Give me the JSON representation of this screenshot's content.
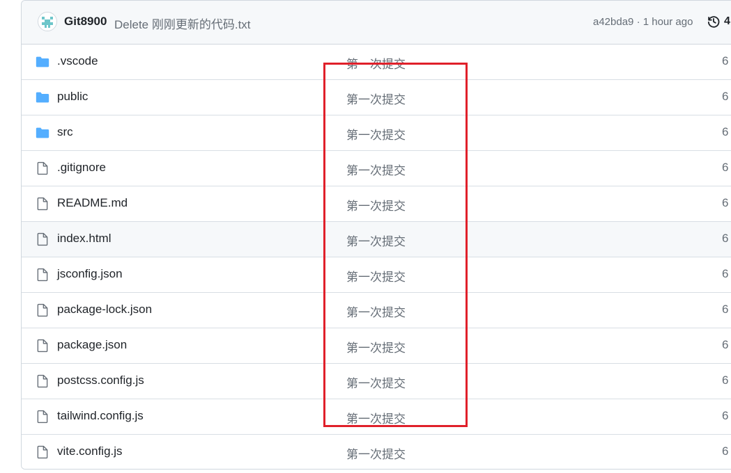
{
  "commit": {
    "author": "Git8900",
    "message": "Delete 刚刚更新的代码.txt",
    "meta": "a42bda9 · 1 hour ago",
    "history_count": "4"
  },
  "files": [
    {
      "type": "folder",
      "name": ".vscode",
      "commit": "第一次提交",
      "age": "6"
    },
    {
      "type": "folder",
      "name": "public",
      "commit": "第一次提交",
      "age": "6"
    },
    {
      "type": "folder",
      "name": "src",
      "commit": "第一次提交",
      "age": "6"
    },
    {
      "type": "file",
      "name": ".gitignore",
      "commit": "第一次提交",
      "age": "6"
    },
    {
      "type": "file",
      "name": "README.md",
      "commit": "第一次提交",
      "age": "6"
    },
    {
      "type": "file",
      "name": "index.html",
      "commit": "第一次提交",
      "age": "6"
    },
    {
      "type": "file",
      "name": "jsconfig.json",
      "commit": "第一次提交",
      "age": "6"
    },
    {
      "type": "file",
      "name": "package-lock.json",
      "commit": "第一次提交",
      "age": "6"
    },
    {
      "type": "file",
      "name": "package.json",
      "commit": "第一次提交",
      "age": "6"
    },
    {
      "type": "file",
      "name": "postcss.config.js",
      "commit": "第一次提交",
      "age": "6"
    },
    {
      "type": "file",
      "name": "tailwind.config.js",
      "commit": "第一次提交",
      "age": "6"
    },
    {
      "type": "file",
      "name": "vite.config.js",
      "commit": "第一次提交",
      "age": "6"
    }
  ],
  "colors": {
    "folder": "#54aeff",
    "file_icon": "#656d76",
    "highlight": "#e0202a",
    "avatar": "#6ec6ca"
  }
}
